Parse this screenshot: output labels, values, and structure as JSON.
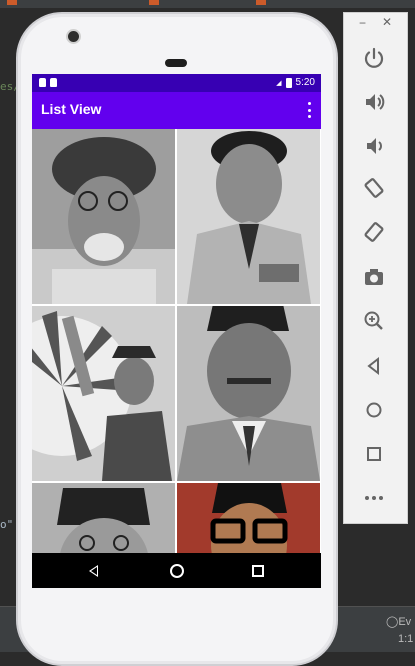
{
  "app": {
    "title": "List View"
  },
  "status_bar": {
    "time": "5:20"
  },
  "grid": {
    "items": [
      {
        "name": "photo-1"
      },
      {
        "name": "photo-2"
      },
      {
        "name": "photo-3"
      },
      {
        "name": "photo-4"
      },
      {
        "name": "photo-5"
      },
      {
        "name": "photo-6"
      }
    ]
  },
  "ide": {
    "left_text_1": "es/",
    "left_text_2": "o\"",
    "status_right": "Ev",
    "status_pos": "1:1"
  },
  "emulator": {
    "minimize": "−",
    "close": "✕"
  },
  "colors": {
    "primary": "#6200ee",
    "primary_dark": "#3700b3"
  }
}
